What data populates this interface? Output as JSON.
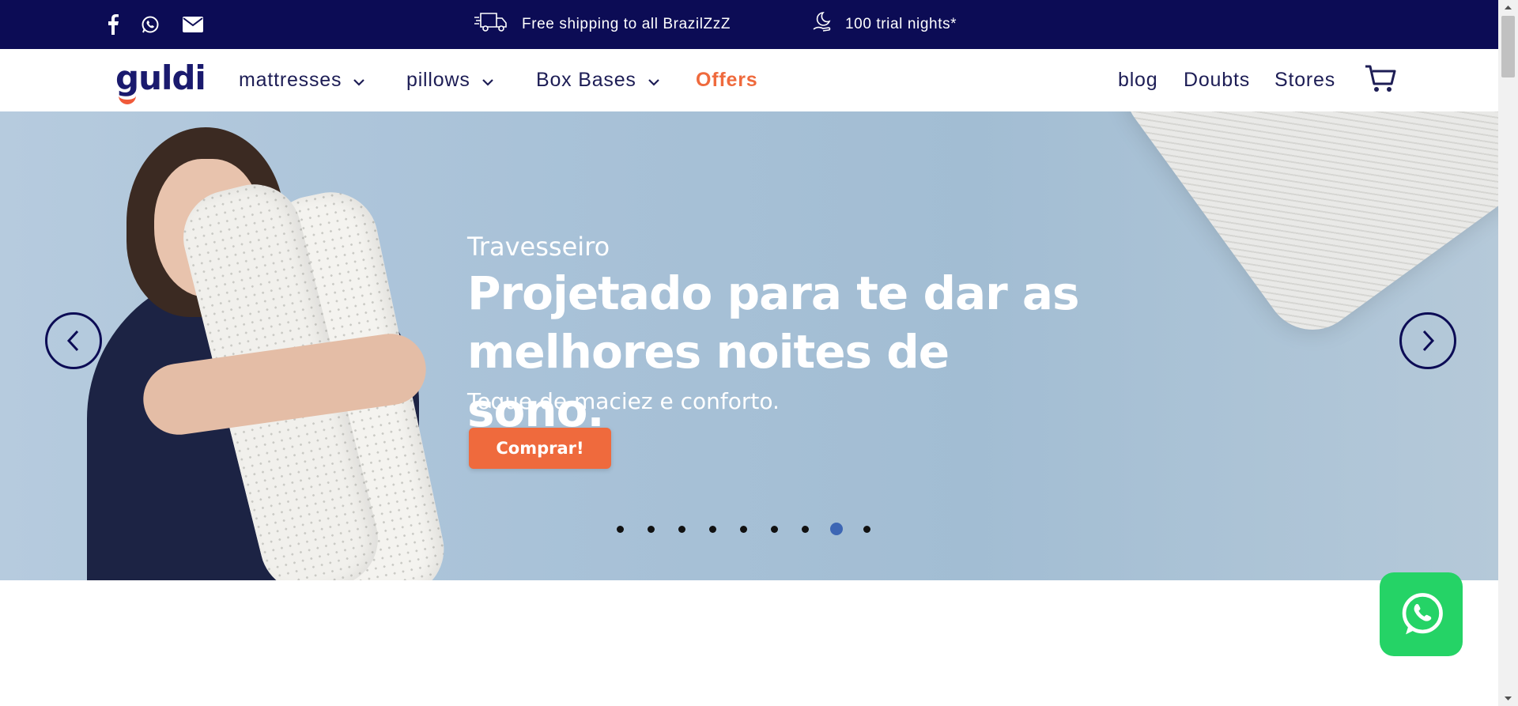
{
  "topbar": {
    "shipping": "Free shipping to all BrazilZzZ",
    "trial": "100 trial nights*",
    "social_icons": [
      "facebook-icon",
      "whatsapp-icon",
      "email-icon"
    ],
    "background": "#0c0c55"
  },
  "nav": {
    "logo": "guldi",
    "items": [
      {
        "label": "mattresses",
        "has_dropdown": true
      },
      {
        "label": "pillows",
        "has_dropdown": true
      },
      {
        "label": "Box Bases",
        "has_dropdown": true
      },
      {
        "label": "Offers",
        "has_dropdown": false
      }
    ],
    "right": [
      "blog",
      "Doubts",
      "Stores"
    ],
    "cart_icon": "cart-icon",
    "accent": "#ef6a3d"
  },
  "hero": {
    "subtitle": "Travesseiro",
    "title": "Projetado para te dar as melhores noites de sono.",
    "description": "Toque de maciez e conforto.",
    "button": "Comprar!",
    "slides_total": 9,
    "active_slide": 8
  },
  "floating": {
    "whatsapp_icon": "whatsapp-icon",
    "color": "#25d366"
  }
}
